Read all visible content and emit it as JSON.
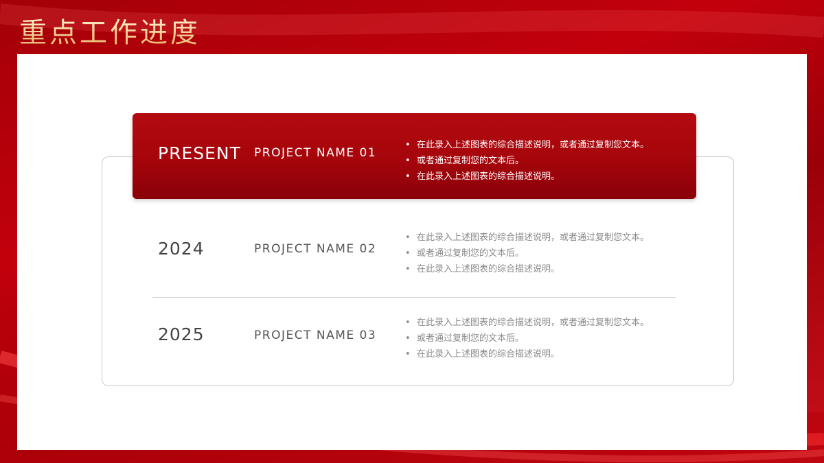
{
  "title": "重点工作进度",
  "rows": [
    {
      "year": "PRESENT",
      "project": "PROJECT NAME 01",
      "bullets": [
        "在此录入上述图表的综合描述说明，或者通过复制您文本。",
        "或者通过复制您的文本后。",
        "在此录入上述图表的综合描述说明。"
      ]
    },
    {
      "year": "2024",
      "project": "PROJECT NAME 02",
      "bullets": [
        "在此录入上述图表的综合描述说明，或者通过复制您文本。",
        "或者通过复制您的文本后。",
        "在此录入上述图表的综合描述说明。"
      ]
    },
    {
      "year": "2025",
      "project": "PROJECT NAME 03",
      "bullets": [
        "在此录入上述图表的综合描述说明，或者通过复制您文本。",
        "或者通过复制您的文本后。",
        "在此录入上述图表的综合描述说明。"
      ]
    }
  ],
  "colors": {
    "accent_red": "#a5050b",
    "title_gold": "#f2c98a",
    "muted_text": "#8a8a8a"
  }
}
